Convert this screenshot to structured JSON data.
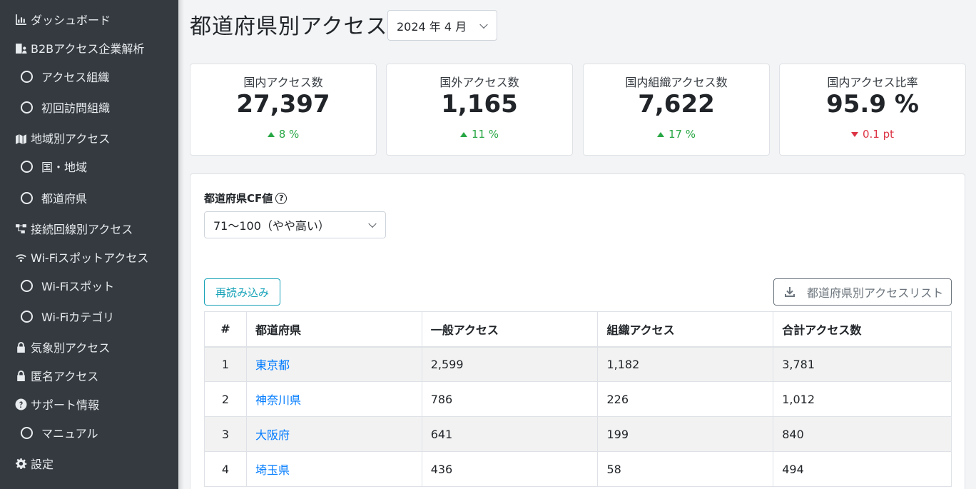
{
  "sidebar": {
    "items": [
      {
        "label": "ダッシュボード",
        "icon": "bar-chart-icon",
        "level": "top"
      },
      {
        "label": "B2Bアクセス企業解析",
        "icon": "building-user-icon",
        "level": "top"
      },
      {
        "label": "アクセス組織",
        "icon": "circle-icon",
        "level": "sub"
      },
      {
        "label": "初回訪問組織",
        "icon": "circle-icon",
        "level": "sub"
      },
      {
        "label": "地域別アクセス",
        "icon": "map-location-icon",
        "level": "top"
      },
      {
        "label": "国・地域",
        "icon": "circle-icon",
        "level": "sub"
      },
      {
        "label": "都道府県",
        "icon": "circle-icon",
        "level": "sub"
      },
      {
        "label": "接続回線別アクセス",
        "icon": "network-icon",
        "level": "top"
      },
      {
        "label": "Wi-Fiスポットアクセス",
        "icon": "wifi-icon",
        "level": "top"
      },
      {
        "label": "Wi-Fiスポット",
        "icon": "circle-icon",
        "level": "sub"
      },
      {
        "label": "Wi-Fiカテゴリ",
        "icon": "circle-icon",
        "level": "sub"
      },
      {
        "label": "気象別アクセス",
        "icon": "lock-icon",
        "level": "top"
      },
      {
        "label": "匿名アクセス",
        "icon": "lock-icon",
        "level": "top"
      },
      {
        "label": "サポート情報",
        "icon": "question-circle-icon",
        "level": "top"
      },
      {
        "label": "マニュアル",
        "icon": "circle-icon",
        "level": "sub"
      },
      {
        "label": "設定",
        "icon": "gear-icon",
        "level": "top"
      }
    ]
  },
  "header": {
    "title": "都道府県別アクセス",
    "month_select": "2024 年 4 月"
  },
  "stats": [
    {
      "label": "国内アクセス数",
      "value": "27,397",
      "change": "8 %",
      "direction": "up"
    },
    {
      "label": "国外アクセス数",
      "value": "1,165",
      "change": "11 %",
      "direction": "up"
    },
    {
      "label": "国内組織アクセス数",
      "value": "7,622",
      "change": "17 %",
      "direction": "up"
    },
    {
      "label": "国内アクセス比率",
      "value": "95.9 %",
      "change": "0.1 pt",
      "direction": "down"
    }
  ],
  "filter": {
    "label": "都道府県CF値",
    "help": "?",
    "selected": "71〜100（やや高い）"
  },
  "buttons": {
    "reload": "再読み込み",
    "download": "都道府県別アクセスリスト"
  },
  "table": {
    "headers": [
      "#",
      "都道府県",
      "一般アクセス",
      "組織アクセス",
      "合計アクセス数"
    ],
    "rows": [
      {
        "rank": "1",
        "pref": "東京都",
        "general": "2,599",
        "org": "1,182",
        "total": "3,781"
      },
      {
        "rank": "2",
        "pref": "神奈川県",
        "general": "786",
        "org": "226",
        "total": "1,012"
      },
      {
        "rank": "3",
        "pref": "大阪府",
        "general": "641",
        "org": "199",
        "total": "840"
      },
      {
        "rank": "4",
        "pref": "埼玉県",
        "general": "436",
        "org": "58",
        "total": "494"
      }
    ]
  },
  "colors": {
    "sidebar_bg": "#343a40",
    "up": "#28a745",
    "down": "#dc3545",
    "link": "#007bff",
    "reload_accent": "#17a2b8"
  }
}
